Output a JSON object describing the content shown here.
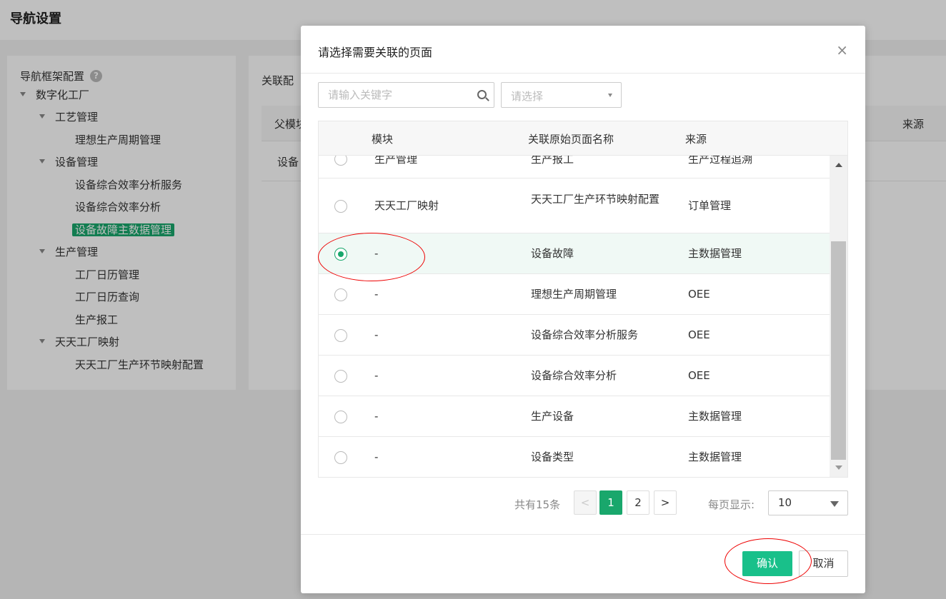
{
  "page": {
    "title": "导航设置"
  },
  "tree": {
    "root_label": "导航框架配置",
    "help": "?",
    "nodes": [
      {
        "label": "数字化工厂",
        "expanded": true
      },
      {
        "label": "工艺管理",
        "expanded": true
      },
      {
        "label": "理想生产周期管理"
      },
      {
        "label": "设备管理",
        "expanded": true
      },
      {
        "label": "设备综合效率分析服务"
      },
      {
        "label": "设备综合效率分析"
      },
      {
        "label": "设备故障主数据管理",
        "selected": true
      },
      {
        "label": "生产管理",
        "expanded": true
      },
      {
        "label": "工厂日历管理"
      },
      {
        "label": "工厂日历查询"
      },
      {
        "label": "生产报工"
      },
      {
        "label": "天天工厂映射",
        "expanded": true
      },
      {
        "label": "天天工厂生产环节映射配置"
      }
    ]
  },
  "content": {
    "label": "关联配",
    "columns": [
      "父模块",
      "来源"
    ],
    "row_cell": "设备"
  },
  "modal": {
    "title": "请选择需要关联的页面",
    "close": "×",
    "search": {
      "placeholder": "请输入关键字"
    },
    "select": {
      "placeholder": "请选择"
    },
    "columns": {
      "module": "模块",
      "page_name": "关联原始页面名称",
      "source": "来源"
    },
    "rows": [
      {
        "module": "生产管理",
        "page_name": "生产报工",
        "source": "生产过程追溯",
        "checked": false
      },
      {
        "module": "天天工厂映射",
        "page_name": "天天工厂生产环节映射配置",
        "source": "订单管理",
        "checked": false
      },
      {
        "module": "-",
        "page_name": "设备故障",
        "source": "主数据管理",
        "checked": true
      },
      {
        "module": "-",
        "page_name": "理想生产周期管理",
        "source": "OEE",
        "checked": false
      },
      {
        "module": "-",
        "page_name": "设备综合效率分析服务",
        "source": "OEE",
        "checked": false
      },
      {
        "module": "-",
        "page_name": "设备综合效率分析",
        "source": "OEE",
        "checked": false
      },
      {
        "module": "-",
        "page_name": "生产设备",
        "source": "主数据管理",
        "checked": false
      },
      {
        "module": "-",
        "page_name": "设备类型",
        "source": "主数据管理",
        "checked": false
      }
    ],
    "pagination": {
      "total": "共有15条",
      "prev": "<",
      "pages": [
        "1",
        "2"
      ],
      "current": "1",
      "next": ">",
      "per_page_label": "每页显示:",
      "per_page": "10"
    },
    "confirm": "确认",
    "cancel": "取消"
  },
  "colors": {
    "accent": "#19a76c",
    "confirm": "#19c08a",
    "annotation": "#e00000"
  }
}
